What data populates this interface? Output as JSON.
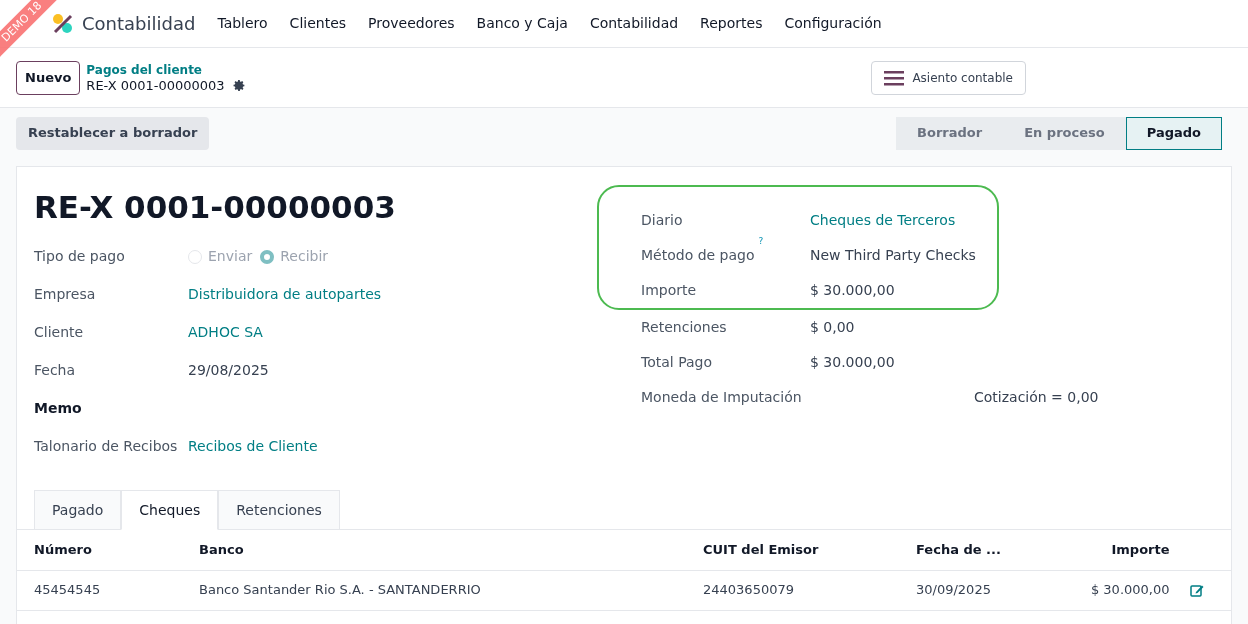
{
  "ribbon": {
    "text": "DEMO 18"
  },
  "navbar": {
    "app": "Contabilidad",
    "menu": [
      "Tablero",
      "Clientes",
      "Proveedores",
      "Banco y Caja",
      "Contabilidad",
      "Reportes",
      "Configuración"
    ]
  },
  "control_panel": {
    "new_button": "Nuevo",
    "breadcrumb": "Pagos del cliente",
    "record": "RE-X 0001-00000003",
    "smart_button": "Asiento contable"
  },
  "status_bar": {
    "action": "Restablecer a borrador",
    "stages": [
      {
        "label": "Borrador",
        "selected": false
      },
      {
        "label": "En proceso",
        "selected": false
      },
      {
        "label": "Pagado",
        "selected": true
      }
    ]
  },
  "form": {
    "title": "RE-X 0001-00000003",
    "payment_type": {
      "label": "Tipo de pago",
      "options": [
        {
          "label": "Enviar",
          "selected": false
        },
        {
          "label": "Recibir",
          "selected": true
        }
      ]
    },
    "left_fields": [
      {
        "label": "Empresa",
        "value": "Distribuidora de autopartes",
        "kind": "link"
      },
      {
        "label": "Cliente",
        "value": "ADHOC SA",
        "kind": "link"
      },
      {
        "label": "Fecha",
        "value": "29/08/2025",
        "kind": "text"
      },
      {
        "label": "Memo",
        "kind": "heading"
      },
      {
        "label": "Talonario de Recibos",
        "value": "Recibos de Cliente",
        "kind": "link"
      }
    ],
    "highlighted_fields": [
      {
        "label": "Diario",
        "value": "Cheques de Terceros",
        "kind": "link"
      },
      {
        "label": "Método de pago",
        "help": "?",
        "value": "New Third Party Checks",
        "kind": "text"
      },
      {
        "label": "Importe",
        "value": "$ 30.000,00",
        "kind": "text"
      }
    ],
    "right_fields": [
      {
        "label": "Retenciones",
        "value": "$ 0,00",
        "kind": "text"
      },
      {
        "label": "Total Pago",
        "value": "$ 30.000,00",
        "kind": "text"
      },
      {
        "label": "Moneda de Imputación",
        "extra": "Cotización = 0,00",
        "kind": "extra"
      }
    ]
  },
  "tabs": [
    {
      "label": "Pagado",
      "selected": false
    },
    {
      "label": "Cheques",
      "selected": true
    },
    {
      "label": "Retenciones",
      "selected": false
    }
  ],
  "table": {
    "columns": [
      "Número",
      "Banco",
      "CUIT del Emisor",
      "Fecha de ...",
      "Importe"
    ],
    "rows": [
      [
        "45454545",
        "Banco Santander Rio S.A. - SANTANDERRIO",
        "24403650079",
        "30/09/2025",
        "$ 30.000,00"
      ]
    ]
  }
}
